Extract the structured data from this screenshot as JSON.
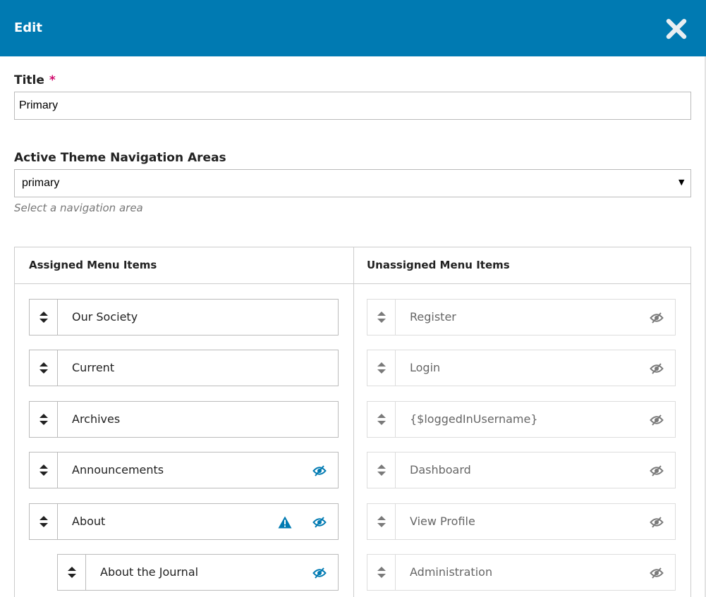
{
  "modal": {
    "title": "Edit"
  },
  "form": {
    "title_label": "Title",
    "required_mark": "*",
    "title_value": "Primary",
    "areas_label": "Active Theme Navigation Areas",
    "areas_value": "primary",
    "areas_help": "Select a navigation area"
  },
  "menus": {
    "assigned_title": "Assigned Menu Items",
    "unassigned_title": "Unassigned Menu Items",
    "assigned": [
      {
        "label": "Our Society"
      },
      {
        "label": "Current"
      },
      {
        "label": "Archives"
      },
      {
        "label": "Announcements",
        "hidden_icon": "eye-slash-icon"
      },
      {
        "label": "About",
        "warning_icon": "warning-icon",
        "hidden_icon": "eye-slash-icon"
      },
      {
        "label": "About the Journal",
        "hidden_icon": "eye-slash-icon"
      }
    ],
    "unassigned": [
      {
        "label": "Register",
        "hidden_icon": "eye-slash-icon"
      },
      {
        "label": "Login",
        "hidden_icon": "eye-slash-icon"
      },
      {
        "label": "{$loggedInUsername}",
        "hidden_icon": "eye-slash-icon"
      },
      {
        "label": "Dashboard",
        "hidden_icon": "eye-slash-icon"
      },
      {
        "label": "View Profile",
        "hidden_icon": "eye-slash-icon"
      },
      {
        "label": "Administration",
        "hidden_icon": "eye-slash-icon"
      }
    ]
  },
  "colors": {
    "header": "#007ab2",
    "accent_icon": "#007ab2",
    "muted_icon": "#7a7a7a",
    "required": "#d00a6c"
  }
}
